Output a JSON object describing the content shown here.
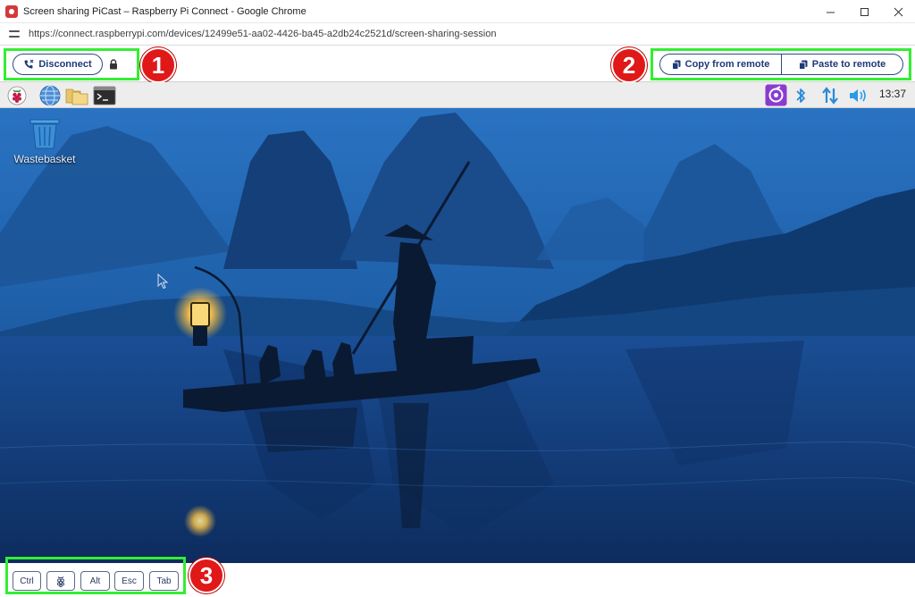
{
  "window": {
    "title": "Screen sharing PiCast – Raspberry Pi Connect - Google Chrome",
    "minimize_icon": "minimize-icon",
    "maximize_icon": "maximize-icon",
    "close_icon": "close-icon"
  },
  "address_bar": {
    "url": "https://connect.raspberrypi.com/devices/12499e51-aa02-4426-ba45-a2db24c2521d/screen-sharing-session"
  },
  "session_toolbar": {
    "disconnect_label": "Disconnect",
    "copy_label": "Copy from remote",
    "paste_label": "Paste to remote",
    "highlight_color": "#33ee33",
    "button_color": "#2c4a86"
  },
  "callouts": {
    "one": "1",
    "two": "2",
    "three": "3",
    "color": "#e01818"
  },
  "taskbar": {
    "clock": "13:37",
    "items": [
      "raspberry-menu-icon",
      "web-browser-icon",
      "file-manager-icon",
      "terminal-icon"
    ],
    "tray": [
      "raspberry-pi-connect-icon",
      "bluetooth-icon",
      "network-icon",
      "volume-icon"
    ]
  },
  "desktop": {
    "icon_label": "Wastebasket"
  },
  "keys": {
    "ctrl": "Ctrl",
    "alt": "Alt",
    "esc": "Esc",
    "tab": "Tab"
  }
}
